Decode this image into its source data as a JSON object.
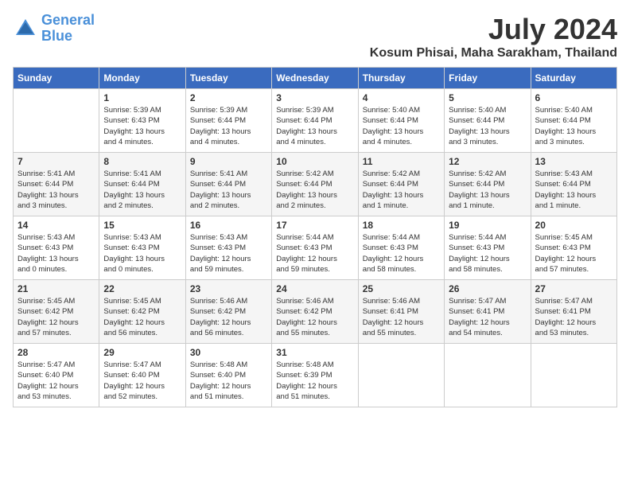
{
  "header": {
    "logo_line1": "General",
    "logo_line2": "Blue",
    "month": "July 2024",
    "location": "Kosum Phisai, Maha Sarakham, Thailand"
  },
  "days_of_week": [
    "Sunday",
    "Monday",
    "Tuesday",
    "Wednesday",
    "Thursday",
    "Friday",
    "Saturday"
  ],
  "weeks": [
    [
      {
        "day": "",
        "info": ""
      },
      {
        "day": "1",
        "info": "Sunrise: 5:39 AM\nSunset: 6:43 PM\nDaylight: 13 hours\nand 4 minutes."
      },
      {
        "day": "2",
        "info": "Sunrise: 5:39 AM\nSunset: 6:44 PM\nDaylight: 13 hours\nand 4 minutes."
      },
      {
        "day": "3",
        "info": "Sunrise: 5:39 AM\nSunset: 6:44 PM\nDaylight: 13 hours\nand 4 minutes."
      },
      {
        "day": "4",
        "info": "Sunrise: 5:40 AM\nSunset: 6:44 PM\nDaylight: 13 hours\nand 4 minutes."
      },
      {
        "day": "5",
        "info": "Sunrise: 5:40 AM\nSunset: 6:44 PM\nDaylight: 13 hours\nand 3 minutes."
      },
      {
        "day": "6",
        "info": "Sunrise: 5:40 AM\nSunset: 6:44 PM\nDaylight: 13 hours\nand 3 minutes."
      }
    ],
    [
      {
        "day": "7",
        "info": "Sunrise: 5:41 AM\nSunset: 6:44 PM\nDaylight: 13 hours\nand 3 minutes."
      },
      {
        "day": "8",
        "info": "Sunrise: 5:41 AM\nSunset: 6:44 PM\nDaylight: 13 hours\nand 2 minutes."
      },
      {
        "day": "9",
        "info": "Sunrise: 5:41 AM\nSunset: 6:44 PM\nDaylight: 13 hours\nand 2 minutes."
      },
      {
        "day": "10",
        "info": "Sunrise: 5:42 AM\nSunset: 6:44 PM\nDaylight: 13 hours\nand 2 minutes."
      },
      {
        "day": "11",
        "info": "Sunrise: 5:42 AM\nSunset: 6:44 PM\nDaylight: 13 hours\nand 1 minute."
      },
      {
        "day": "12",
        "info": "Sunrise: 5:42 AM\nSunset: 6:44 PM\nDaylight: 13 hours\nand 1 minute."
      },
      {
        "day": "13",
        "info": "Sunrise: 5:43 AM\nSunset: 6:44 PM\nDaylight: 13 hours\nand 1 minute."
      }
    ],
    [
      {
        "day": "14",
        "info": "Sunrise: 5:43 AM\nSunset: 6:43 PM\nDaylight: 13 hours\nand 0 minutes."
      },
      {
        "day": "15",
        "info": "Sunrise: 5:43 AM\nSunset: 6:43 PM\nDaylight: 13 hours\nand 0 minutes."
      },
      {
        "day": "16",
        "info": "Sunrise: 5:43 AM\nSunset: 6:43 PM\nDaylight: 12 hours\nand 59 minutes."
      },
      {
        "day": "17",
        "info": "Sunrise: 5:44 AM\nSunset: 6:43 PM\nDaylight: 12 hours\nand 59 minutes."
      },
      {
        "day": "18",
        "info": "Sunrise: 5:44 AM\nSunset: 6:43 PM\nDaylight: 12 hours\nand 58 minutes."
      },
      {
        "day": "19",
        "info": "Sunrise: 5:44 AM\nSunset: 6:43 PM\nDaylight: 12 hours\nand 58 minutes."
      },
      {
        "day": "20",
        "info": "Sunrise: 5:45 AM\nSunset: 6:43 PM\nDaylight: 12 hours\nand 57 minutes."
      }
    ],
    [
      {
        "day": "21",
        "info": "Sunrise: 5:45 AM\nSunset: 6:42 PM\nDaylight: 12 hours\nand 57 minutes."
      },
      {
        "day": "22",
        "info": "Sunrise: 5:45 AM\nSunset: 6:42 PM\nDaylight: 12 hours\nand 56 minutes."
      },
      {
        "day": "23",
        "info": "Sunrise: 5:46 AM\nSunset: 6:42 PM\nDaylight: 12 hours\nand 56 minutes."
      },
      {
        "day": "24",
        "info": "Sunrise: 5:46 AM\nSunset: 6:42 PM\nDaylight: 12 hours\nand 55 minutes."
      },
      {
        "day": "25",
        "info": "Sunrise: 5:46 AM\nSunset: 6:41 PM\nDaylight: 12 hours\nand 55 minutes."
      },
      {
        "day": "26",
        "info": "Sunrise: 5:47 AM\nSunset: 6:41 PM\nDaylight: 12 hours\nand 54 minutes."
      },
      {
        "day": "27",
        "info": "Sunrise: 5:47 AM\nSunset: 6:41 PM\nDaylight: 12 hours\nand 53 minutes."
      }
    ],
    [
      {
        "day": "28",
        "info": "Sunrise: 5:47 AM\nSunset: 6:40 PM\nDaylight: 12 hours\nand 53 minutes."
      },
      {
        "day": "29",
        "info": "Sunrise: 5:47 AM\nSunset: 6:40 PM\nDaylight: 12 hours\nand 52 minutes."
      },
      {
        "day": "30",
        "info": "Sunrise: 5:48 AM\nSunset: 6:40 PM\nDaylight: 12 hours\nand 51 minutes."
      },
      {
        "day": "31",
        "info": "Sunrise: 5:48 AM\nSunset: 6:39 PM\nDaylight: 12 hours\nand 51 minutes."
      },
      {
        "day": "",
        "info": ""
      },
      {
        "day": "",
        "info": ""
      },
      {
        "day": "",
        "info": ""
      }
    ]
  ]
}
